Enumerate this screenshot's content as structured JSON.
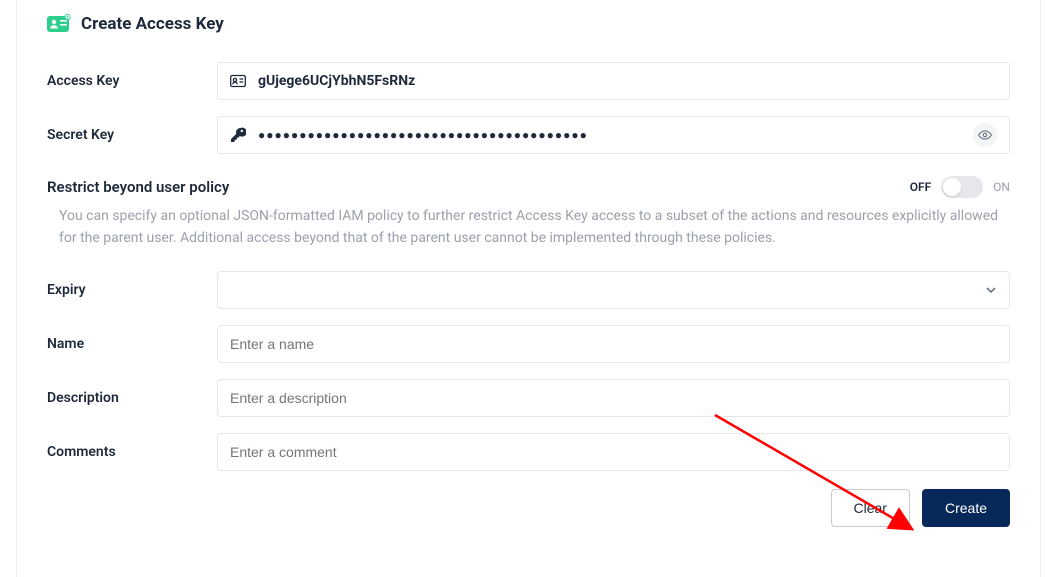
{
  "header": {
    "title": "Create Access Key"
  },
  "fields": {
    "accessKey": {
      "label": "Access Key",
      "value": "gUjege6UCjYbhN5FsRNz"
    },
    "secretKey": {
      "label": "Secret Key",
      "masked": "●●●●●●●●●●●●●●●●●●●●●●●●●●●●●●●●●●●●●●●●"
    },
    "expiry": {
      "label": "Expiry",
      "value": ""
    },
    "name": {
      "label": "Name",
      "placeholder": "Enter a name"
    },
    "description": {
      "label": "Description",
      "placeholder": "Enter a description"
    },
    "comments": {
      "label": "Comments",
      "placeholder": "Enter a comment"
    }
  },
  "restrict": {
    "title": "Restrict beyond user policy",
    "offLabel": "OFF",
    "onLabel": "ON",
    "state": "off",
    "description": "You can specify an optional JSON-formatted IAM policy to further restrict Access Key access to a subset of the actions and resources explicitly allowed for the parent user. Additional access beyond that of the parent user cannot be implemented through these policies."
  },
  "actions": {
    "clear": "Clear",
    "create": "Create"
  }
}
